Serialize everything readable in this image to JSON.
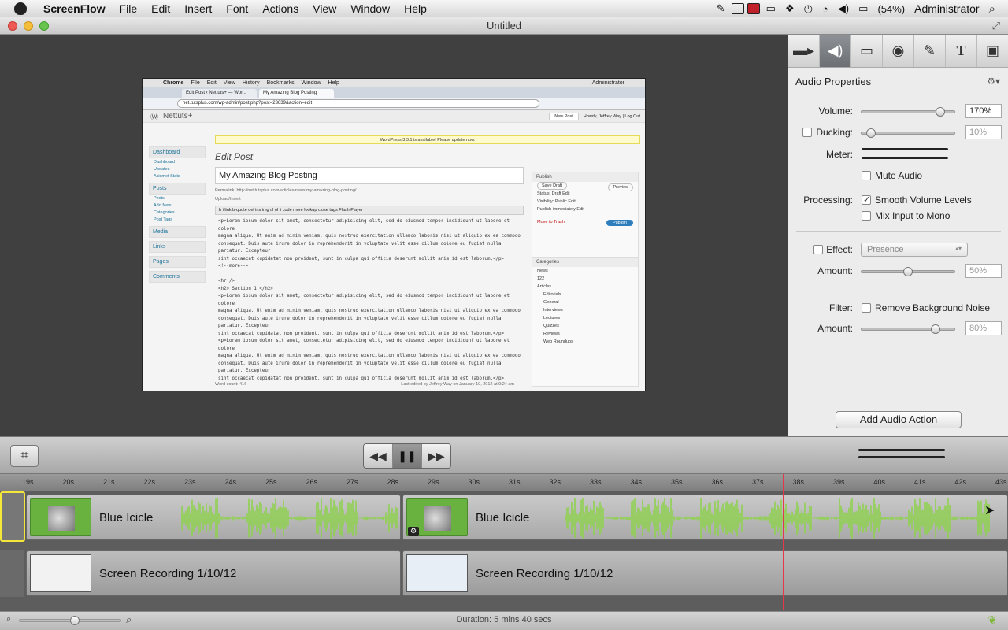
{
  "menubar": {
    "app": "ScreenFlow",
    "items": [
      "File",
      "Edit",
      "Insert",
      "Font",
      "Actions",
      "View",
      "Window",
      "Help"
    ],
    "battery": "(54%)",
    "user": "Administrator"
  },
  "window": {
    "title": "Untitled"
  },
  "recording": {
    "chrome_menu": [
      "Chrome",
      "File",
      "Edit",
      "View",
      "History",
      "Bookmarks",
      "Window",
      "Help"
    ],
    "chrome_user": "Administrator",
    "tabs": [
      "Edit Post ‹ Nettuts+ — Wor...",
      "My Amazing Blog Posting"
    ],
    "url": "net.tutsplus.com/wp-admin/post.php?post=23639&action=edit",
    "site_name": "Nettuts+",
    "update_notice": "WordPress 3.3.1 is available! Please update now.",
    "howdy": "Howdy, Jeffrey Way | Log Out",
    "new_post": "New Post",
    "page_heading": "Edit Post",
    "post_title": "My Amazing Blog Posting",
    "permalink": "Permalink: http://net.tutsplus.com/articles/news/my-amazing-blog-posting/",
    "upload_insert": "Upload/Insert",
    "editor_buttons": "b  i  link  b-quote  del  ins  img  ul  ol  li  code  more  lookup  close tags  Flash Player",
    "body_text": "<p>Lorem ipsum dolor sit amet, consectetur adipisicing elit, sed do eiusmod tempor incididunt ut labore et dolore\nmagna aliqua. Ut enim ad minim veniam, quis nostrud exercitation ullamco laboris nisi ut aliquip ex ea commodo\nconsequat. Duis aute irure dolor in reprehenderit in voluptate velit esse cillum dolore eu fugiat nulla pariatur. Excepteur\nsint occaecat cupidatat non proident, sunt in culpa qui officia deserunt mollit anim id est laborum.</p>\n<!--more-->\n\n<hr />\n<h2> Section 1 </h2>\n<p>Lorem ipsum dolor sit amet, consectetur adipisicing elit, sed do eiusmod tempor incididunt ut labore et dolore\nmagna aliqua. Ut enim ad minim veniam, quis nostrud exercitation ullamco laboris nisi ut aliquip ex ea commodo\nconsequat. Duis aute irure dolor in reprehenderit in voluptate velit esse cillum dolore eu fugiat nulla pariatur. Excepteur\nsint occaecat cupidatat non proident, sunt in culpa qui officia deserunt mollit anim id est laborum.</p>\n<p>Lorem ipsum dolor sit amet, consectetur adipisicing elit, sed do eiusmod tempor incididunt ut labore et dolore\nmagna aliqua. Ut enim ad minim veniam, quis nostrud exercitation ullamco laboris nisi ut aliquip ex ea commodo\nconsequat. Duis aute irure dolor in reprehenderit in voluptate velit esse cillum dolore eu fugiat nulla pariatur. Excepteur\nsint occaecat cupidatat non proident, sunt in culpa qui officia deserunt mollit anim id est laborum.</p>",
    "sidebar": [
      "Dashboard",
      "Posts",
      "Media",
      "Links",
      "Pages",
      "Comments"
    ],
    "sidebar_sub": [
      "Dashboard",
      "Updates",
      "Akismet Stats",
      "Posts",
      "Add New",
      "Categories",
      "Post Tags"
    ],
    "publish_title": "Publish",
    "save_draft": "Save Draft",
    "preview": "Preview",
    "status": "Status: Draft Edit",
    "visibility": "Visibility: Public Edit",
    "publish_immediately": "Publish immediately Edit",
    "move_to_trash": "Move to Trash",
    "publish_btn": "Publish",
    "categories_title": "Categories",
    "categories": [
      "News",
      "122",
      "Articles",
      "Editorials",
      "General",
      "Interviews",
      "Lectures",
      "Quizzes",
      "Reviews",
      "Web Roundups"
    ],
    "word_count": "Word count: 416",
    "last_edited": "Last edited by Jeffrey Way on January 10, 2012 at 9:24 am"
  },
  "inspector": {
    "tabs": [
      "video",
      "audio",
      "screen",
      "callout",
      "annotation",
      "text",
      "media"
    ],
    "active_tab": "audio",
    "title": "Audio Properties",
    "volume_label": "Volume:",
    "volume_value": "170%",
    "volume_level": 0.85,
    "ducking_label": "Ducking:",
    "ducking_value": "10%",
    "ducking_level": 0.1,
    "meter_label": "Meter:",
    "mute_label": "Mute Audio",
    "processing_label": "Processing:",
    "smooth_label": "Smooth Volume Levels",
    "mono_label": "Mix Input to Mono",
    "effect_label": "Effect:",
    "effect_value": "Presence",
    "amount_label": "Amount:",
    "effect_amount_value": "50%",
    "effect_amount_level": 0.5,
    "filter_label": "Filter:",
    "remove_noise_label": "Remove Background Noise",
    "filter_amount_value": "80%",
    "filter_amount_level": 0.8,
    "add_action": "Add Audio Action"
  },
  "timeline": {
    "ticks": [
      "19s",
      "20s",
      "21s",
      "22s",
      "23s",
      "24s",
      "25s",
      "26s",
      "27s",
      "28s",
      "29s",
      "30s",
      "31s",
      "32s",
      "33s",
      "34s",
      "35s",
      "36s",
      "37s",
      "38s",
      "39s",
      "40s",
      "41s",
      "42s",
      "43s"
    ],
    "audio_clips": [
      "Blue Icicle",
      "Blue Icicle"
    ],
    "video_clips": [
      "Screen Recording 1/10/12",
      "Screen Recording 1/10/12"
    ],
    "duration": "Duration: 5 mins 40 secs"
  },
  "colors": {
    "wave": "#8fd150",
    "playhead": "#e23a4a",
    "selection": "#f5e63a"
  }
}
